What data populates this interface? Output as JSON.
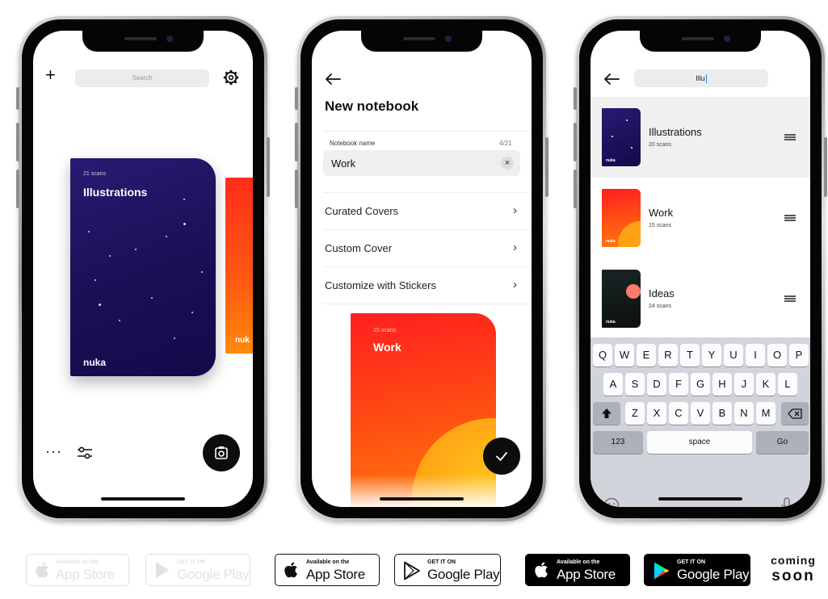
{
  "phone1": {
    "search_placeholder": "Search",
    "notebook": {
      "scans": "21 scans",
      "title": "Illustrations",
      "brand": "nuka"
    },
    "peek_brand": "nuk",
    "dots": "···",
    "colors": {
      "notebook": "#1a0f55",
      "peek": "#ff4614"
    }
  },
  "phone2": {
    "title": "New notebook",
    "field_label": "Notebook name",
    "field_count": "4/21",
    "field_value": "Work",
    "clear_glyph": "×",
    "rows": [
      {
        "label": "Curated Covers"
      },
      {
        "label": "Custom Cover"
      },
      {
        "label": "Customize with Stickers"
      }
    ],
    "chevron": "›",
    "preview": {
      "scans": "15 scans",
      "title": "Work"
    }
  },
  "phone3": {
    "search_value": "Illu",
    "items": [
      {
        "name": "Illustrations",
        "scans": "20 scans",
        "brand": "nuka"
      },
      {
        "name": "Work",
        "scans": "15 scans",
        "brand": "nuka"
      },
      {
        "name": "Ideas",
        "scans": "24 scans",
        "brand": "nuka"
      }
    ],
    "keyboard": {
      "row1": [
        "Q",
        "W",
        "E",
        "R",
        "T",
        "Y",
        "U",
        "I",
        "O",
        "P"
      ],
      "row2": [
        "A",
        "S",
        "D",
        "F",
        "G",
        "H",
        "J",
        "K",
        "L"
      ],
      "row3": [
        "Z",
        "X",
        "C",
        "V",
        "B",
        "N",
        "M"
      ],
      "num_label": "123",
      "space_label": "space",
      "go_label": "Go"
    }
  },
  "badges": {
    "apple_small": "Available on the",
    "apple_big": "App Store",
    "google_small": "GET IT ON",
    "google_big": "Google Play",
    "coming_1": "coming",
    "coming_2": "soon"
  }
}
